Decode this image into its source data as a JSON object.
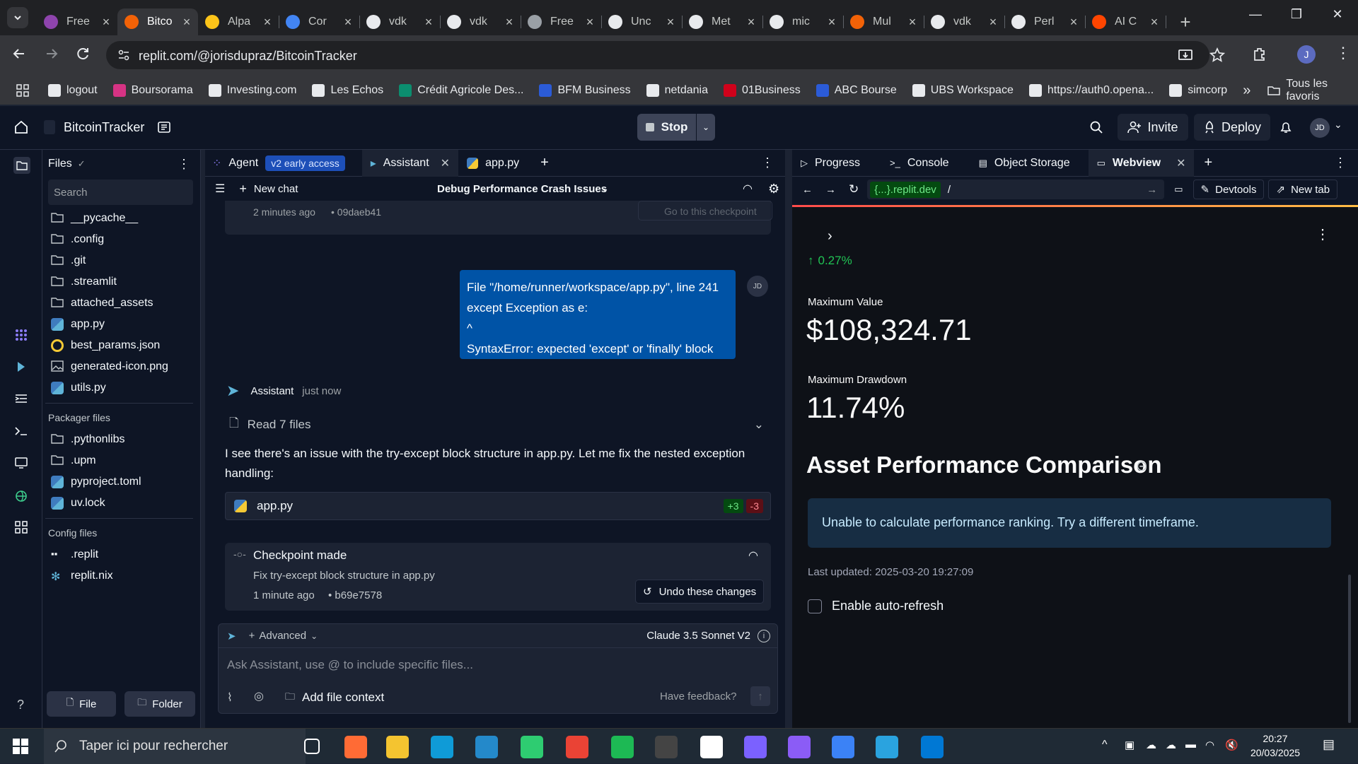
{
  "browser": {
    "tabs": [
      {
        "label": "Free",
        "icon": "wolf-icon",
        "color": "#8e44ad"
      },
      {
        "label": "Bitco",
        "icon": "replit-icon",
        "color": "#f26207",
        "active": true
      },
      {
        "label": "Alpa",
        "icon": "alpaca-icon",
        "color": "#fcc419"
      },
      {
        "label": "Cor",
        "icon": "circle-icon",
        "color": "#4285f4"
      },
      {
        "label": "vdk",
        "icon": "github-icon",
        "color": "#e8eaed"
      },
      {
        "label": "vdk",
        "icon": "github-icon",
        "color": "#e8eaed"
      },
      {
        "label": "Free",
        "icon": "wolf-icon",
        "color": "#9aa0a6"
      },
      {
        "label": "Unc",
        "icon": "doc-icon",
        "color": "#e8eaed"
      },
      {
        "label": "Met",
        "icon": "doc-icon",
        "color": "#e8eaed"
      },
      {
        "label": "mic",
        "icon": "crown-icon",
        "color": "#e8eaed"
      },
      {
        "label": "Mul",
        "icon": "replit-icon",
        "color": "#f26207"
      },
      {
        "label": "vdk",
        "icon": "github-icon",
        "color": "#e8eaed"
      },
      {
        "label": "Perl",
        "icon": "openai-icon",
        "color": "#e8eaed"
      },
      {
        "label": "AI C",
        "icon": "reddit-icon",
        "color": "#ff4500"
      }
    ],
    "url": "replit.com/@jorisdupraz/BitcoinTracker",
    "profile_initial": "J",
    "bookmarks": [
      "logout",
      "Boursorama",
      "Investing.com",
      "Les Echos",
      "Crédit Agricole Des...",
      "BFM Business",
      "netdania",
      "01Business",
      "ABC Bourse",
      "UBS Workspace",
      "https://auth0.opena...",
      "simcorp"
    ],
    "bookmark_colors": [
      "#e8eaed",
      "#d63384",
      "#e8eaed",
      "#e8eaed",
      "#0b8e6f",
      "#2b5bd7",
      "#e8eaed",
      "#d0021b",
      "#2b5bd7",
      "#e8eaed",
      "#e8eaed",
      "#e8eaed"
    ],
    "all_bookmarks": "Tous les favoris"
  },
  "replit": {
    "project": "BitcoinTracker",
    "stop_label": "Stop",
    "invite_label": "Invite",
    "deploy_label": "Deploy",
    "avatar": "JD"
  },
  "files": {
    "title": "Files",
    "search_placeholder": "Search",
    "items": [
      {
        "name": "__pycache__",
        "type": "folder"
      },
      {
        "name": ".config",
        "type": "folder"
      },
      {
        "name": ".git",
        "type": "folder"
      },
      {
        "name": ".streamlit",
        "type": "folder"
      },
      {
        "name": "attached_assets",
        "type": "folder"
      },
      {
        "name": "app.py",
        "type": "python"
      },
      {
        "name": "best_params.json",
        "type": "json"
      },
      {
        "name": "generated-icon.png",
        "type": "image"
      },
      {
        "name": "utils.py",
        "type": "python"
      }
    ],
    "packager_title": "Packager files",
    "packager": [
      {
        "name": ".pythonlibs",
        "type": "folder"
      },
      {
        "name": ".upm",
        "type": "folder"
      },
      {
        "name": "pyproject.toml",
        "type": "python"
      },
      {
        "name": "uv.lock",
        "type": "python"
      }
    ],
    "config_title": "Config files",
    "config": [
      {
        "name": ".replit",
        "type": "replit"
      },
      {
        "name": "replit.nix",
        "type": "nix"
      }
    ],
    "file_btn": "File",
    "folder_btn": "Folder"
  },
  "middle": {
    "tabs": {
      "agent": "Agent",
      "agent_badge": "v2 early access",
      "assistant": "Assistant",
      "app": "app.py"
    },
    "new_chat": "New chat",
    "chat_title": "Debug Performance Crash Issues",
    "prev_checkpoint": {
      "time": "2 minutes ago",
      "hash": "• 09daeb41",
      "action": "Go to this checkpoint"
    },
    "user_msg": [
      "File \"/home/runner/workspace/app.py\", line 241",
      "except Exception as e:",
      "^",
      "SyntaxError: expected 'except' or 'finally' block"
    ],
    "user_avatar": "JD",
    "assistant_name": "Assistant",
    "assistant_time": "just now",
    "read_files": "Read 7 files",
    "reply": "I see there's an issue with the try-except block structure in app.py. Let me fix the nested exception handling:",
    "diff_file": "app.py",
    "diff_add": "+3",
    "diff_del": "-3",
    "checkpoint": {
      "title": "Checkpoint made",
      "desc": "Fix try-except block structure in app.py",
      "time": "1 minute ago",
      "hash": "• b69e7578",
      "undo": "Undo these changes"
    },
    "advanced": "Advanced",
    "model": "Claude 3.5 Sonnet V2",
    "input_placeholder": "Ask Assistant, use @ to include specific files...",
    "add_context": "Add file context",
    "feedback": "Have feedback?"
  },
  "right": {
    "tabs": {
      "progress": "Progress",
      "console": "Console",
      "storage": "Object Storage",
      "webview": "Webview"
    },
    "url_host": "{...}.replit.dev",
    "url_path": "/",
    "devtools": "Devtools",
    "newtab": "New tab",
    "change": "0.27%",
    "max_value_label": "Maximum Value",
    "max_value": "$108,324.71",
    "drawdown_label": "Maximum Drawdown",
    "drawdown": "11.74%",
    "section_title": "Asset Performance Comparison",
    "info": "Unable to calculate performance ranking. Try a different timeframe.",
    "updated": "Last updated: 2025-03-20 19:27:09",
    "autorefresh": "Enable auto-refresh"
  },
  "taskbar": {
    "search": "Taper ici pour rechercher",
    "time": "20:27",
    "date": "20/03/2025",
    "apps": [
      {
        "name": "task-view-icon",
        "color": "#ffffff"
      },
      {
        "name": "app-icon",
        "color": "#ff6b35"
      },
      {
        "name": "explorer-icon",
        "color": "#f4c430"
      },
      {
        "name": "edge-icon",
        "color": "#0f9bd7"
      },
      {
        "name": "vscode-icon",
        "color": "#2489ca"
      },
      {
        "name": "app-icon",
        "color": "#2ecc71"
      },
      {
        "name": "chrome-icon",
        "color": "#ea4335"
      },
      {
        "name": "app-icon",
        "color": "#1db954"
      },
      {
        "name": "app-icon",
        "color": "#444444"
      },
      {
        "name": "github-icon",
        "color": "#ffffff"
      },
      {
        "name": "m365-icon",
        "color": "#7b61ff"
      },
      {
        "name": "github-desktop-icon",
        "color": "#8b5cf6"
      },
      {
        "name": "app-icon",
        "color": "#3b82f6"
      },
      {
        "name": "telegram-icon",
        "color": "#2aa3df"
      },
      {
        "name": "outlook-icon",
        "color": "#0078d4"
      }
    ]
  }
}
